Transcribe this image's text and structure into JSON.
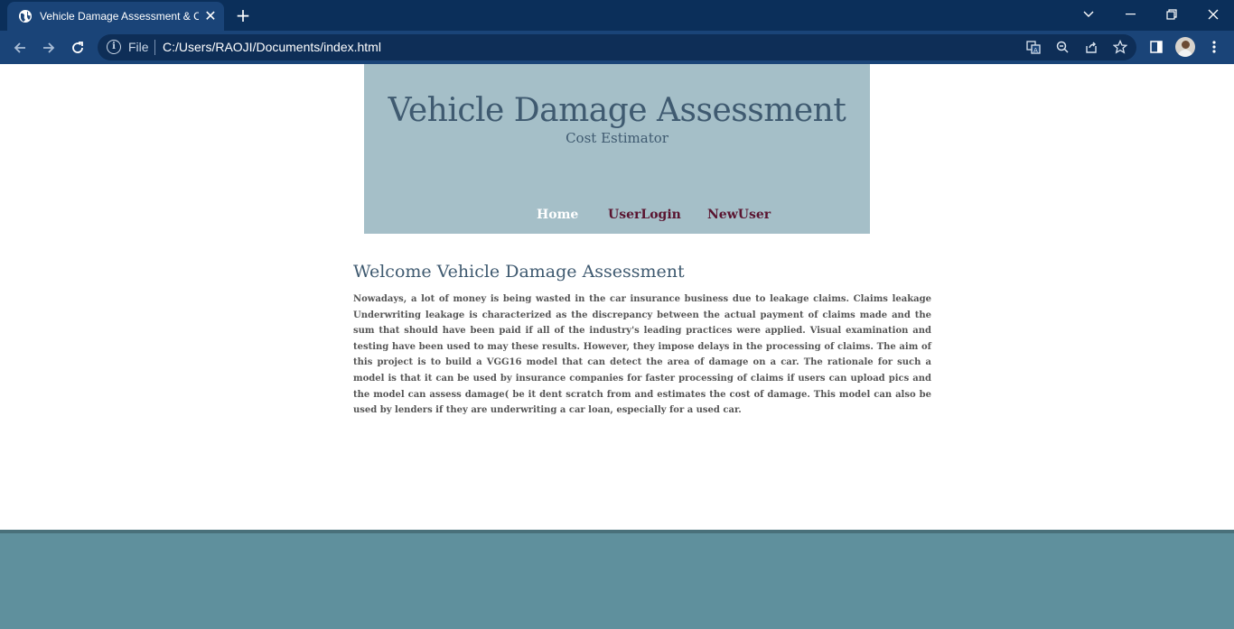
{
  "browser": {
    "tab": {
      "title": "Vehicle Damage Assessment & Cost Estimator",
      "favicon": "globe-icon",
      "close_icon": "close-icon"
    },
    "new_tab_icon": "plus-icon",
    "window_controls": [
      "chevron-down-icon",
      "minimize-icon",
      "restore-icon",
      "close-icon"
    ],
    "address_bar": {
      "scheme_label": "File",
      "url": "C:/Users/RAOJI/Documents/index.html"
    },
    "toolbar_icons": [
      "translate-icon",
      "zoom-icon",
      "share-icon",
      "star-icon",
      "side-panel-icon",
      "profile-avatar",
      "more-menu-icon"
    ],
    "colors": {
      "tab_strip": "#0b2f5a",
      "toolbar": "#1a4478",
      "omnibox": "#0e2e57"
    }
  },
  "header": {
    "title": "Vehicle Damage Assessment",
    "subtitle": "Cost Estimator",
    "nav": [
      {
        "label": "Home",
        "color": "#ffffff"
      },
      {
        "label": "UserLogin",
        "color": "#5a1430"
      },
      {
        "label": "NewUser",
        "color": "#5a1430"
      }
    ],
    "background": "#a5bfc8"
  },
  "main": {
    "heading": "Welcome Vehicle Damage Assessment",
    "body": "Nowadays, a lot of money is being wasted in the car insurance business due to leakage claims. Claims leakage Underwriting leakage is characterized as the discrepancy between the actual payment of claims made and the sum that should have been paid if all of the industry's leading practices were applied. Visual examination and testing have been used to may these results. However, they impose delays in the processing of claims. The aim of this project is to build a VGG16 model that can detect the area of damage on a car. The rationale for such a model is that it can be used by insurance companies for faster processing of claims if users can upload pics and the model can assess damage( be it dent scratch from and estimates the cost of damage. This model can also be used by lenders if they are underwriting a car loan, especially for a used car."
  },
  "footer": {
    "background": "#5f909d"
  }
}
